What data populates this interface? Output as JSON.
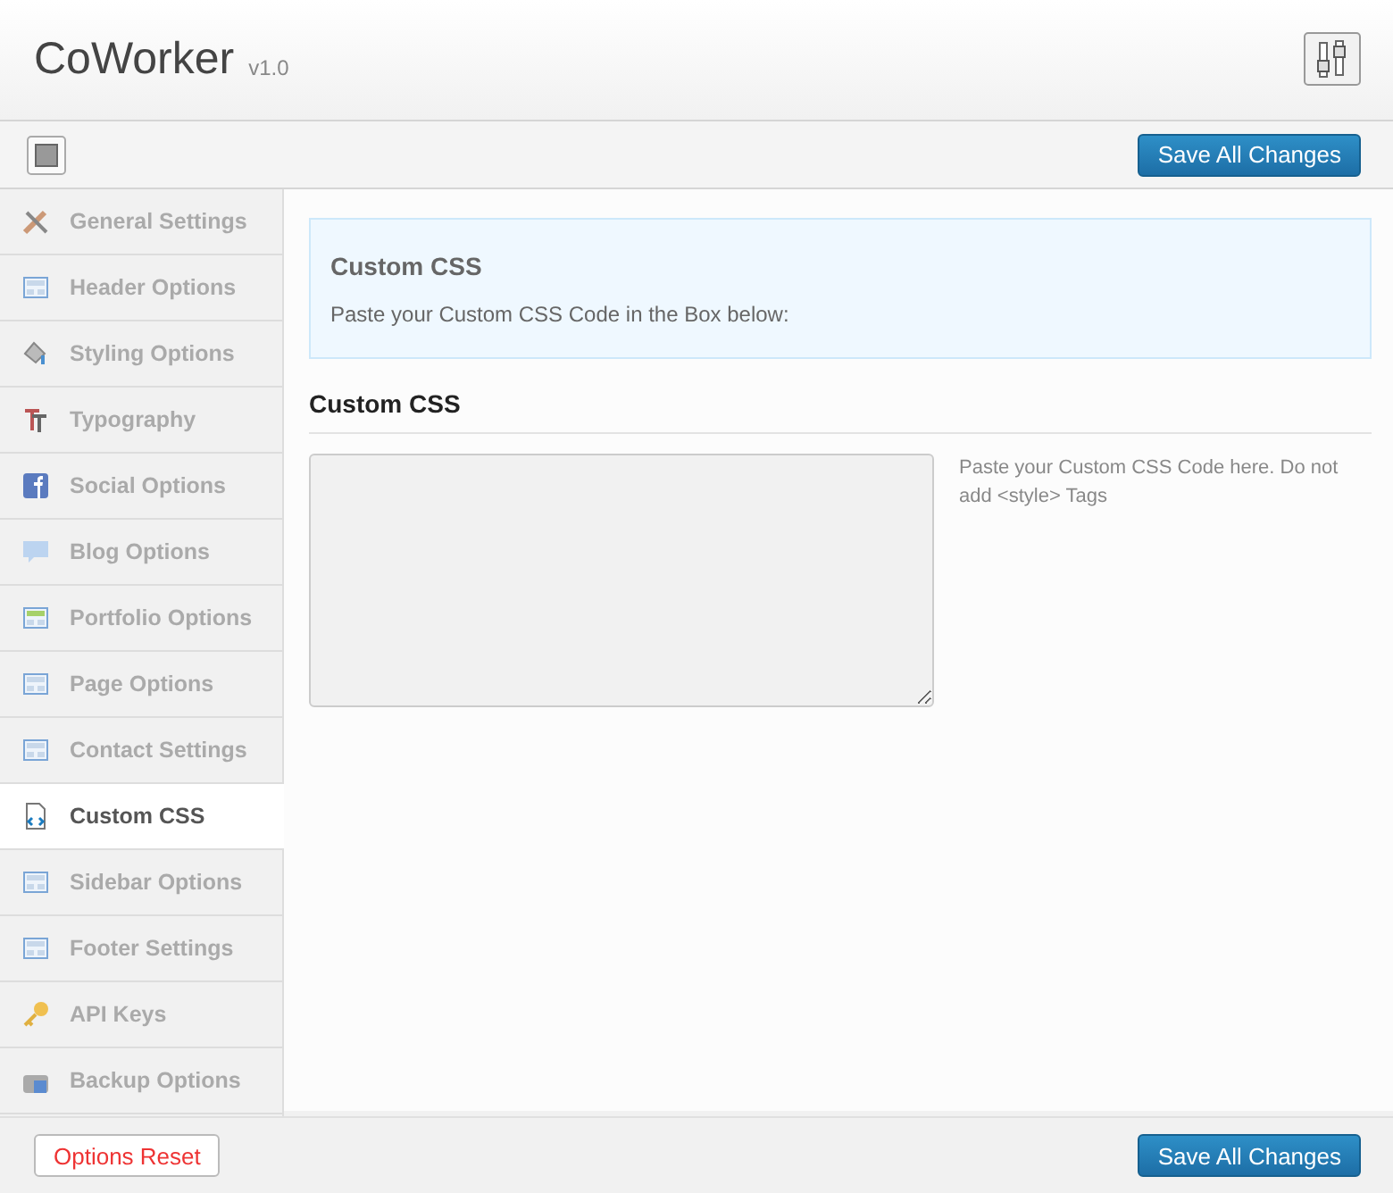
{
  "header": {
    "title": "CoWorker",
    "version": "v1.0"
  },
  "toolbar": {
    "save_button": "Save All Changes"
  },
  "sidebar": {
    "items": [
      {
        "label": "General Settings",
        "selected": false
      },
      {
        "label": "Header Options",
        "selected": false
      },
      {
        "label": "Styling Options",
        "selected": false
      },
      {
        "label": "Typography",
        "selected": false
      },
      {
        "label": "Social Options",
        "selected": false
      },
      {
        "label": "Blog Options",
        "selected": false
      },
      {
        "label": "Portfolio Options",
        "selected": false
      },
      {
        "label": "Page Options",
        "selected": false
      },
      {
        "label": "Contact Settings",
        "selected": false
      },
      {
        "label": "Custom CSS",
        "selected": true
      },
      {
        "label": "Sidebar Options",
        "selected": false
      },
      {
        "label": "Footer Settings",
        "selected": false
      },
      {
        "label": "API Keys",
        "selected": false
      },
      {
        "label": "Backup Options",
        "selected": false
      }
    ]
  },
  "info_box": {
    "title": "Custom CSS",
    "text": "Paste your Custom CSS Code in the Box below:"
  },
  "section": {
    "title": "Custom CSS",
    "hint": "Paste your Custom CSS Code here. Do not add <style> Tags"
  },
  "footer": {
    "reset_button": "Options Reset",
    "save_button": "Save All Changes"
  }
}
